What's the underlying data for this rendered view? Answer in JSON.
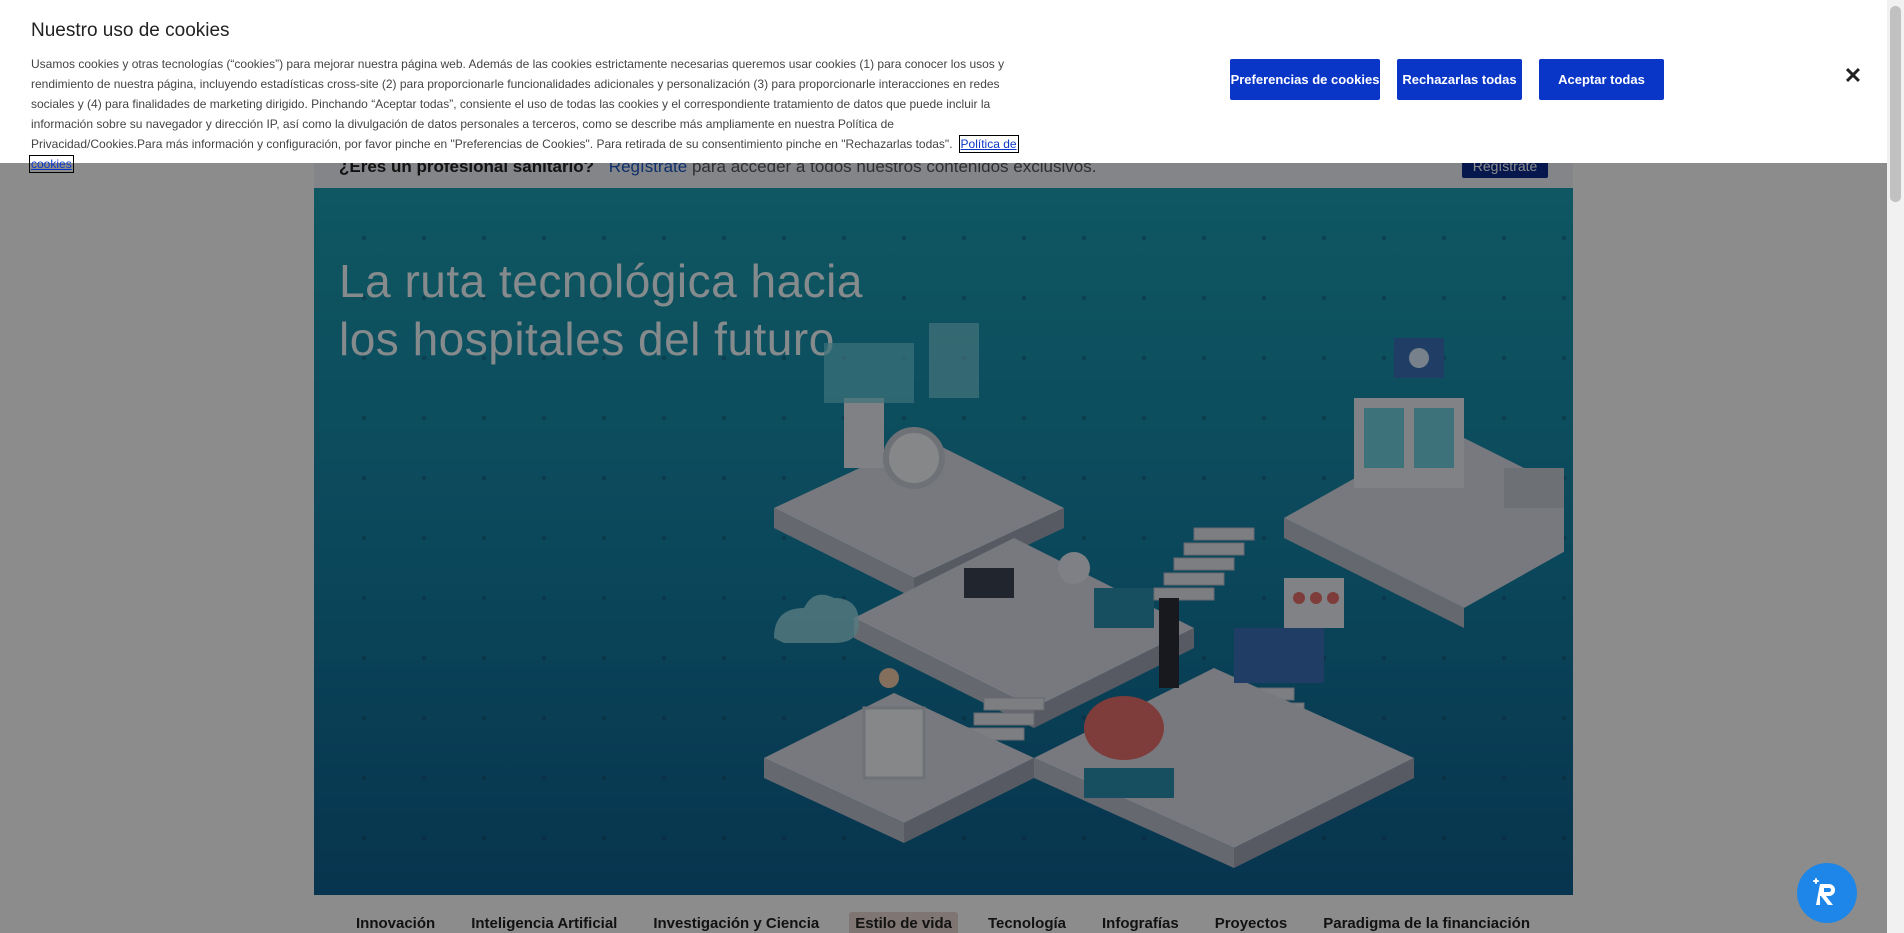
{
  "cookie_banner": {
    "title": "Nuestro uso de cookies",
    "body": "Usamos cookies y otras tecnologías (“cookies”) para mejorar nuestra página web. Además de las cookies estrictamente necesarias queremos usar cookies (1) para conocer los usos y rendimiento de nuestra página, incluyendo estadísticas cross-site (2) para proporcionarle funcionalidades adicionales y personalización (3) para proporcionarle interacciones en redes sociales y (4) para finalidades de marketing dirigido. Pinchando “Aceptar todas”, consiente el uso de todas las cookies y el correspondiente tratamiento de datos que puede incluir la información sobre su navegador y dirección IP, así como la divulgación de datos personales a terceros, como se describe más ampliamente en nuestra Política de Privacidad/Cookies.Para más información y configuración, por favor pinche en \"Preferencias de Cookies\". Para retirada de su consentimiento pinche en \"Rechazarlas todas\".",
    "policy_link": "Política de cookies",
    "buttons": {
      "preferences": "Preferencias de cookies",
      "reject": "Rechazarlas todas",
      "accept": "Aceptar todas"
    },
    "close_icon": "close-icon"
  },
  "register_bar": {
    "question": "¿Eres un profesional sanitario?",
    "link": "Regístrate",
    "rest": "para acceder a todos nuestros contenidos exclusivos.",
    "button": "Regístrate"
  },
  "hero": {
    "title": "La ruta tecnológica hacia los hospitales del futuro"
  },
  "nav": {
    "tabs": [
      "Innovación",
      "Inteligencia Artificial",
      "Investigación y Ciencia",
      "Estilo de vida",
      "Tecnología",
      "Infografías",
      "Proyectos",
      "Paradigma de la financiación"
    ],
    "active_index": 3
  },
  "colors": {
    "primary_button": "#0a36c8",
    "hero_bg": "#1480a5",
    "assistant": "#1e86e8"
  }
}
